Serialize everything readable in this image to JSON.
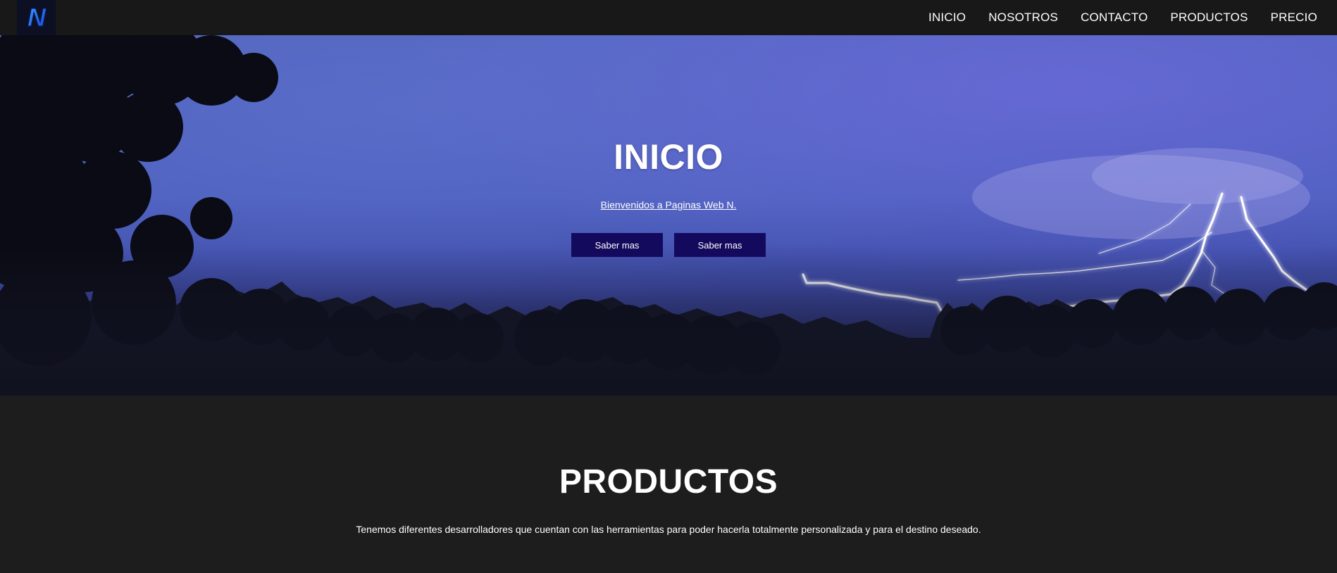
{
  "nav": {
    "logo_letter": "N",
    "links": [
      "INICIO",
      "NOSOTROS",
      "CONTACTO",
      "PRODUCTOS",
      "PRECIO"
    ]
  },
  "hero": {
    "title": "INICIO",
    "subtitle": "Bienvenidos a Paginas Web N.",
    "buttons": [
      "Saber mas",
      "Saber mas"
    ]
  },
  "productos": {
    "title": "PRODUCTOS",
    "text": "Tenemos diferentes desarrolladores que cuentan con las herramientas para poder hacerla totalmente personalizada y para el destino deseado."
  },
  "colors": {
    "navbar_bg": "#181818",
    "button_bg": "#130a5e",
    "section_bg": "#1e1d1e",
    "sky": "#4f63bd"
  }
}
